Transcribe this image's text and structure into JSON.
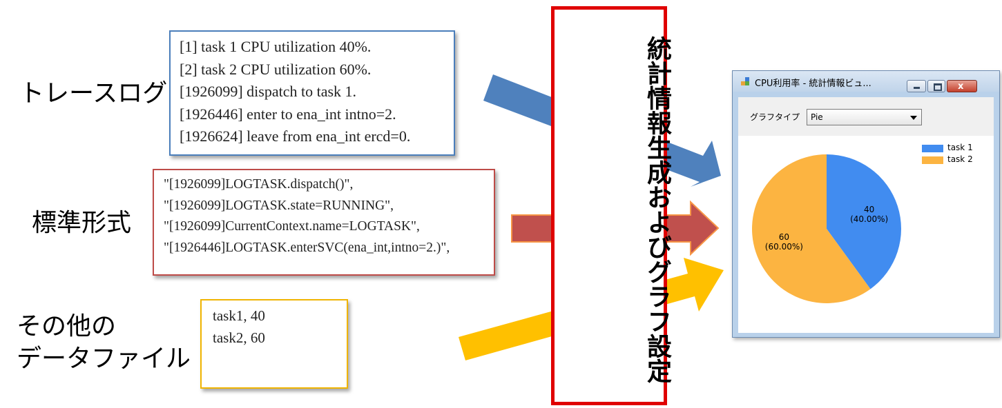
{
  "labels": {
    "trace_log": "トレースログ",
    "standard_format": "標準形式",
    "other_data_line1": "その他の",
    "other_data_line2": "データファイル"
  },
  "trace_log_lines": [
    "[1] task 1 CPU utilization 40%.",
    "[2] task 2 CPU utilization 60%.",
    "[1926099] dispatch to task 1.",
    "[1926446] enter to ena_int intno=2.",
    "[1926624] leave from ena_int ercd=0."
  ],
  "standard_format_lines": [
    "\"[1926099]LOGTASK.dispatch()\",",
    "\"[1926099]LOGTASK.state=RUNNING\",",
    "\"[1926099]CurrentContext.name=LOGTASK\",",
    "\"[1926446]LOGTASK.enterSVC(ena_int,intno=2.)\","
  ],
  "data_file_lines": [
    "task1, 40",
    "task2, 60"
  ],
  "center_text": "統計情報生成およびグラフ設定",
  "window": {
    "title": "CPU利用率 - 統計情報ビュ...",
    "graph_type_label": "グラフタイプ",
    "graph_type_value": "Pie",
    "close_glyph": "x"
  },
  "colors": {
    "arrow_blue": "#4f81bd",
    "arrow_red": "#c0504d",
    "arrow_yellow": "#ffc000",
    "center_border": "#e00000"
  },
  "chart_data": {
    "type": "pie",
    "series": [
      {
        "name": "task 1",
        "value": 40,
        "label": "40",
        "percent_label": "(40.00%)",
        "color": "#418cf0"
      },
      {
        "name": "task 2",
        "value": 60,
        "label": "60",
        "percent_label": "(60.00%)",
        "color": "#fcb441"
      }
    ],
    "legend_position": "top-right"
  }
}
